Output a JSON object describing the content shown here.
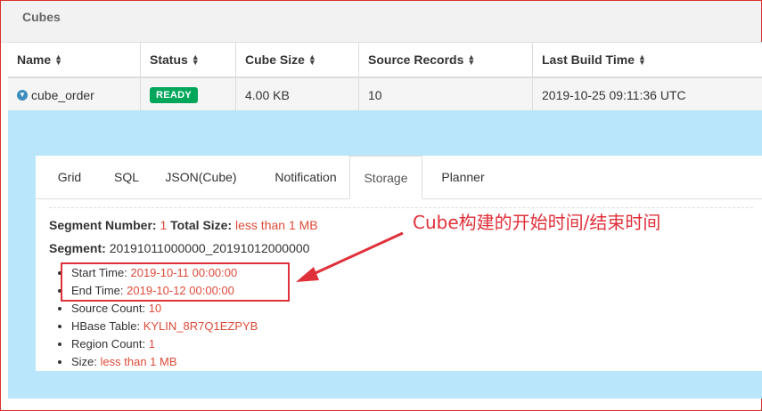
{
  "header": {
    "title": "Cubes"
  },
  "table": {
    "columns": [
      "Name",
      "Status",
      "Cube Size",
      "Source Records",
      "Last Build Time"
    ],
    "rows": [
      {
        "name": "cube_order",
        "status": "READY",
        "cube_size": "4.00 KB",
        "source_records": "10",
        "last_build_time": "2019-10-25 09:11:36 UTC"
      }
    ]
  },
  "tabs": [
    "Grid",
    "SQL",
    "JSON(Cube)",
    "Notification",
    "Storage",
    "Planner"
  ],
  "active_tab": "Storage",
  "storage": {
    "segment_number_label": "Segment Number:",
    "segment_number": "1",
    "total_size_label": "Total Size:",
    "total_size": "less than 1 MB",
    "segment_label": "Segment:",
    "segment": "20191011000000_20191012000000",
    "details": [
      {
        "label": "Start Time:",
        "value": "2019-10-11 00:00:00"
      },
      {
        "label": "End Time:",
        "value": "2019-10-12 00:00:00"
      },
      {
        "label": "Source Count:",
        "value": "10"
      },
      {
        "label": "HBase Table:",
        "value": "KYLIN_8R7Q1EZPYB"
      },
      {
        "label": "Region Count:",
        "value": "1"
      },
      {
        "label": "Size:",
        "value": "less than 1 MB"
      }
    ]
  },
  "annotation": {
    "text": "Cube构建的开始时间/结束时间"
  },
  "colors": {
    "ready_badge": "#00a65a",
    "value_red": "#dd4b39",
    "annotation_red": "#e0303a",
    "detail_bg": "#b9e6fb"
  }
}
